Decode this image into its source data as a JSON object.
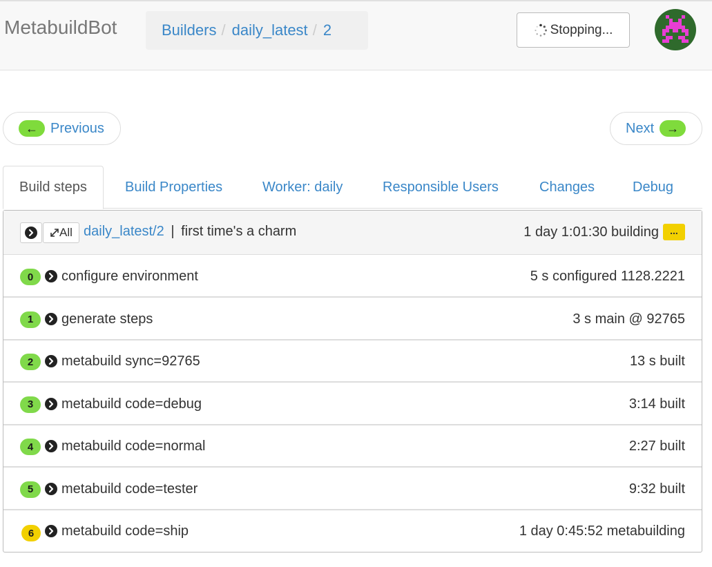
{
  "navbar": {
    "brand": "MetabuildBot",
    "breadcrumb": [
      "Builders",
      "daily_latest",
      "2"
    ],
    "stop_button": "Stopping..."
  },
  "pager": {
    "previous": "Previous",
    "next": "Next",
    "prev_arrow": "←",
    "next_arrow": "→"
  },
  "tabs": [
    {
      "label": "Build steps",
      "active": true
    },
    {
      "label": "Build Properties",
      "active": false
    },
    {
      "label": "Worker: daily",
      "active": false
    },
    {
      "label": "Responsible Users",
      "active": false
    },
    {
      "label": "Changes",
      "active": false
    },
    {
      "label": "Debug",
      "active": false
    }
  ],
  "build": {
    "all_label": "All",
    "link": "daily_latest/2",
    "separator": "|",
    "reason": "first time's a charm",
    "status": "1 day 1:01:30 building",
    "dots": "..."
  },
  "steps": [
    {
      "num": "0",
      "name": "configure environment",
      "summary": "5 s configured 1128.2221",
      "state": "success"
    },
    {
      "num": "1",
      "name": "generate steps",
      "summary": "3 s main @ 92765",
      "state": "success"
    },
    {
      "num": "2",
      "name": "metabuild sync=92765",
      "summary": "13 s built",
      "state": "success"
    },
    {
      "num": "3",
      "name": "metabuild code=debug",
      "summary": "3:14 built",
      "state": "success"
    },
    {
      "num": "4",
      "name": "metabuild code=normal",
      "summary": "2:27 built",
      "state": "success"
    },
    {
      "num": "5",
      "name": "metabuild code=tester",
      "summary": "9:32 built",
      "state": "success"
    },
    {
      "num": "6",
      "name": "metabuild code=ship",
      "summary": "1 day 0:45:52 metabuilding",
      "state": "running"
    }
  ],
  "colors": {
    "link": "#3a87c8",
    "success": "#80d94a",
    "running": "#f2d000",
    "avatar_bg": "#2f6a2c",
    "avatar_fg": "#e83ed4"
  },
  "icons": {
    "spinner": "spinner-icon",
    "avatar": "pixel-invader-avatar",
    "expand": "chevron-circle-right-icon",
    "expand_all": "expand-arrows-icon",
    "step": "chevron-circle-right-icon"
  }
}
